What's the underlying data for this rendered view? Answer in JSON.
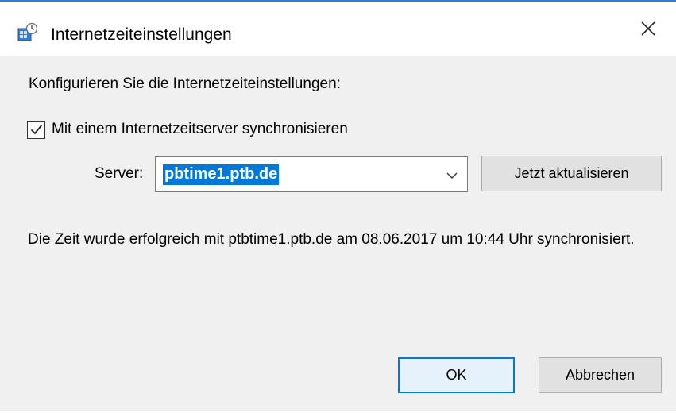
{
  "window": {
    "title": "Internetzeiteinstellungen",
    "accent_color": "#0078d7"
  },
  "dialog": {
    "heading": "Konfigurieren Sie die Internetzeiteinstellungen:",
    "sync_checkbox": {
      "label": "Mit einem Internetzeitserver synchronisieren",
      "checked": true
    },
    "server": {
      "label": "Server:",
      "value": "pbtime1.ptb.de"
    },
    "update_button": "Jetzt aktualisieren",
    "status": "Die Zeit wurde erfolgreich mit ptbtime1.ptb.de am 08.06.2017 um 10:44 Uhr synchronisiert.",
    "ok_button": "OK",
    "cancel_button": "Abbrechen"
  },
  "icons": {
    "app": "internet-time-clock-icon",
    "close": "close-icon",
    "dropdown": "chevron-down-icon",
    "check": "checkmark-icon"
  }
}
